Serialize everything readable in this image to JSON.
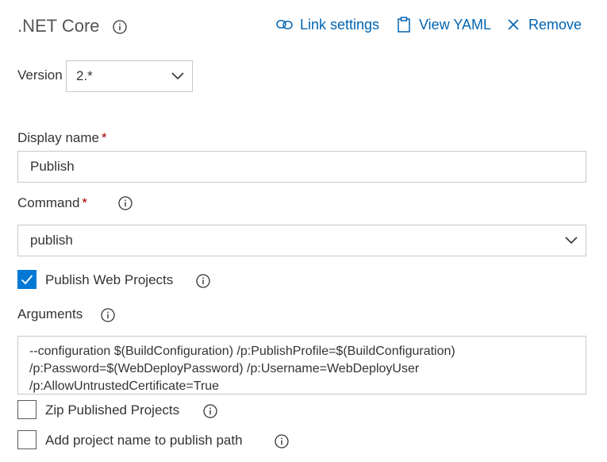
{
  "header": {
    "title": ".NET Core",
    "actions": {
      "link_settings": "Link settings",
      "view_yaml": "View YAML",
      "remove": "Remove"
    }
  },
  "version": {
    "label": "Version",
    "value": "2.*"
  },
  "display_name": {
    "label": "Display name",
    "required_marker": "*",
    "value": "Publish"
  },
  "command": {
    "label": "Command",
    "required_marker": "*",
    "value": "publish"
  },
  "publish_web_projects": {
    "label": "Publish Web Projects",
    "checked": true
  },
  "arguments": {
    "label": "Arguments",
    "value": "--configuration $(BuildConfiguration) /p:PublishProfile=$(BuildConfiguration)\n/p:Password=$(WebDeployPassword) /p:Username=WebDeployUser\n/p:AllowUntrustedCertificate=True"
  },
  "zip_published_projects": {
    "label": "Zip Published Projects",
    "checked": false
  },
  "add_project_name": {
    "label": "Add project name to publish path",
    "checked": false
  },
  "colors": {
    "accent": "#0078d4",
    "link": "#0063b1",
    "required": "#a80000",
    "border": "#c8c8c8"
  },
  "icons": {
    "info": "info-icon",
    "link": "link-icon",
    "yaml": "clipboard-icon",
    "remove": "close-icon",
    "chevron": "chevron-down-icon",
    "check": "checkmark-icon"
  }
}
